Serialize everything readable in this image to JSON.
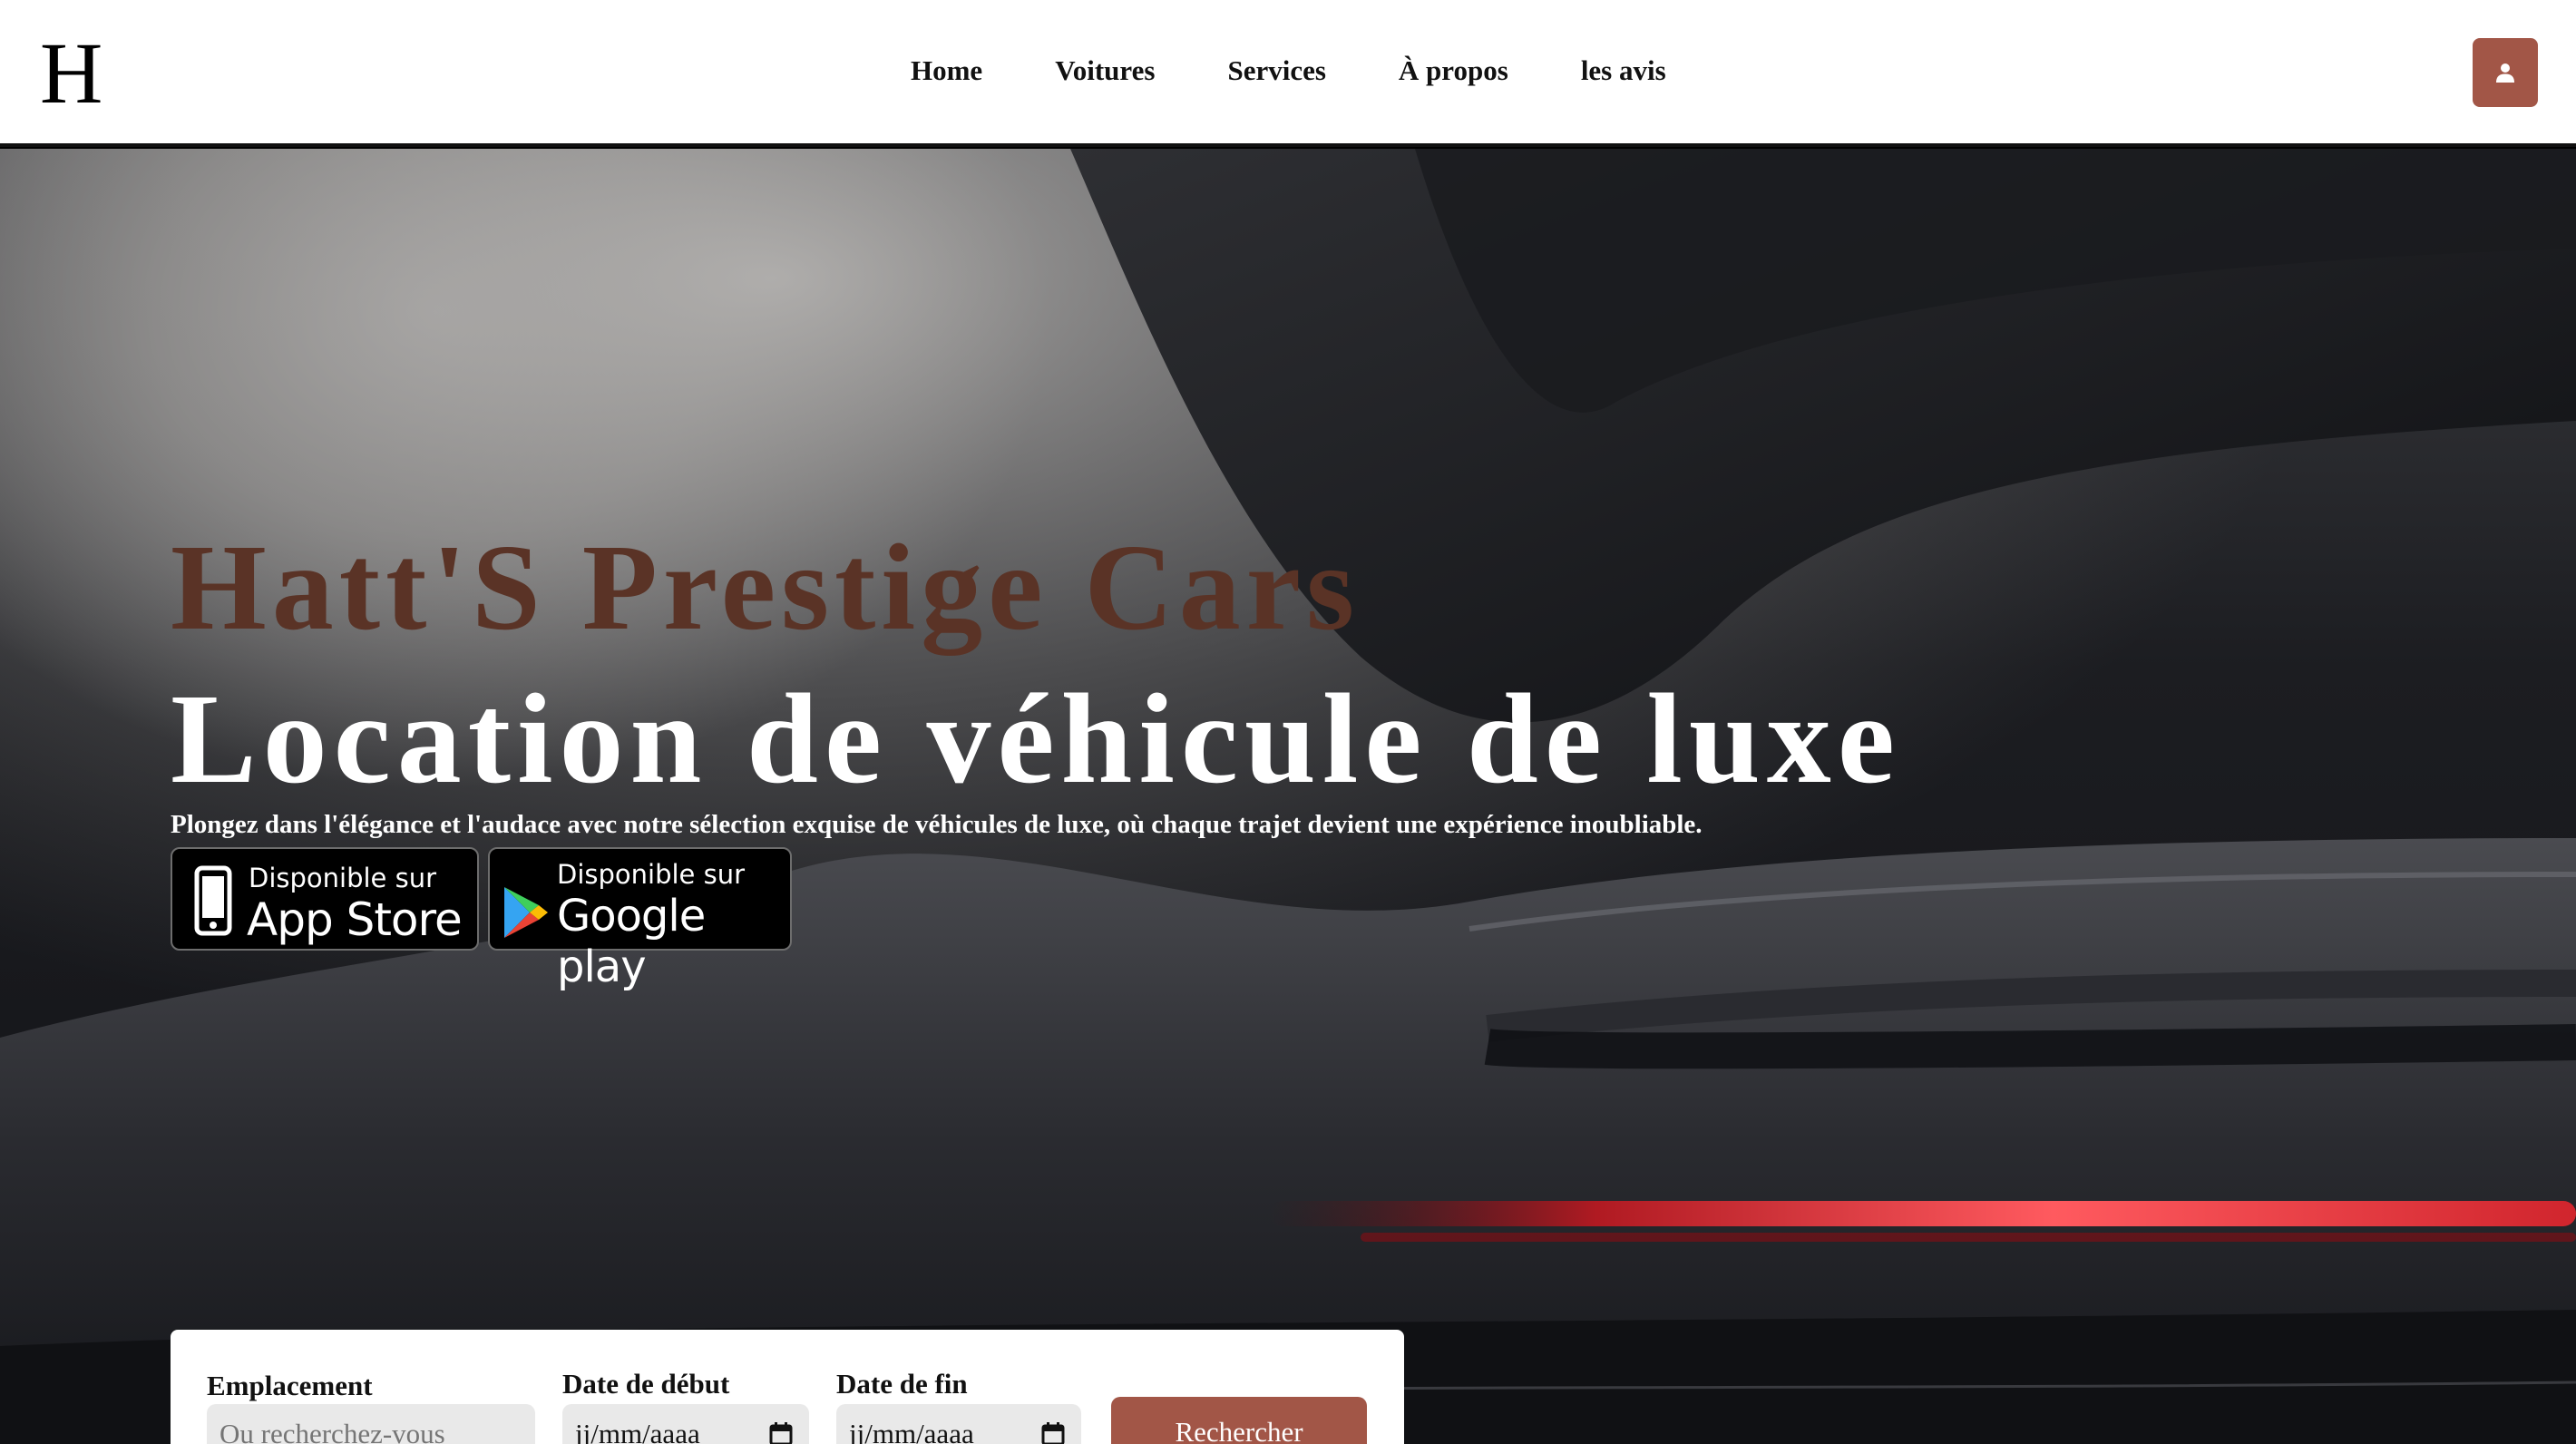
{
  "brand": {
    "logo_letter": "H"
  },
  "nav": {
    "items": [
      {
        "label": "Home"
      },
      {
        "label": "Voitures"
      },
      {
        "label": "Services"
      },
      {
        "label": "À propos"
      },
      {
        "label": "les avis"
      }
    ],
    "user_icon": "user-icon"
  },
  "hero": {
    "title": "Hatt'S Prestige Cars",
    "subtitle": "Location de véhicule de luxe",
    "description": "Plongez dans l'élégance et l'audace avec notre sélection exquise de véhicules de luxe, où chaque trajet devient une expérience inoubliable.",
    "badges": {
      "apple": {
        "small": "Disponible sur",
        "big": "App Store",
        "icon": "phone-icon"
      },
      "google": {
        "small": "Disponible sur",
        "big": "Google play",
        "icon": "play-store-icon"
      }
    }
  },
  "search": {
    "location_label": "Emplacement",
    "location_placeholder": "Ou recherchez-vous",
    "start_label": "Date de début",
    "start_value": "jj/mm/aaaa",
    "end_label": "Date de fin",
    "end_value": "jj/mm/aaaa",
    "button_label": "Rechercher",
    "calendar_icon": "calendar-icon"
  },
  "colors": {
    "accent": "#a25647",
    "title_brown": "#5a3326",
    "navbar_bg": "#ffffff"
  }
}
